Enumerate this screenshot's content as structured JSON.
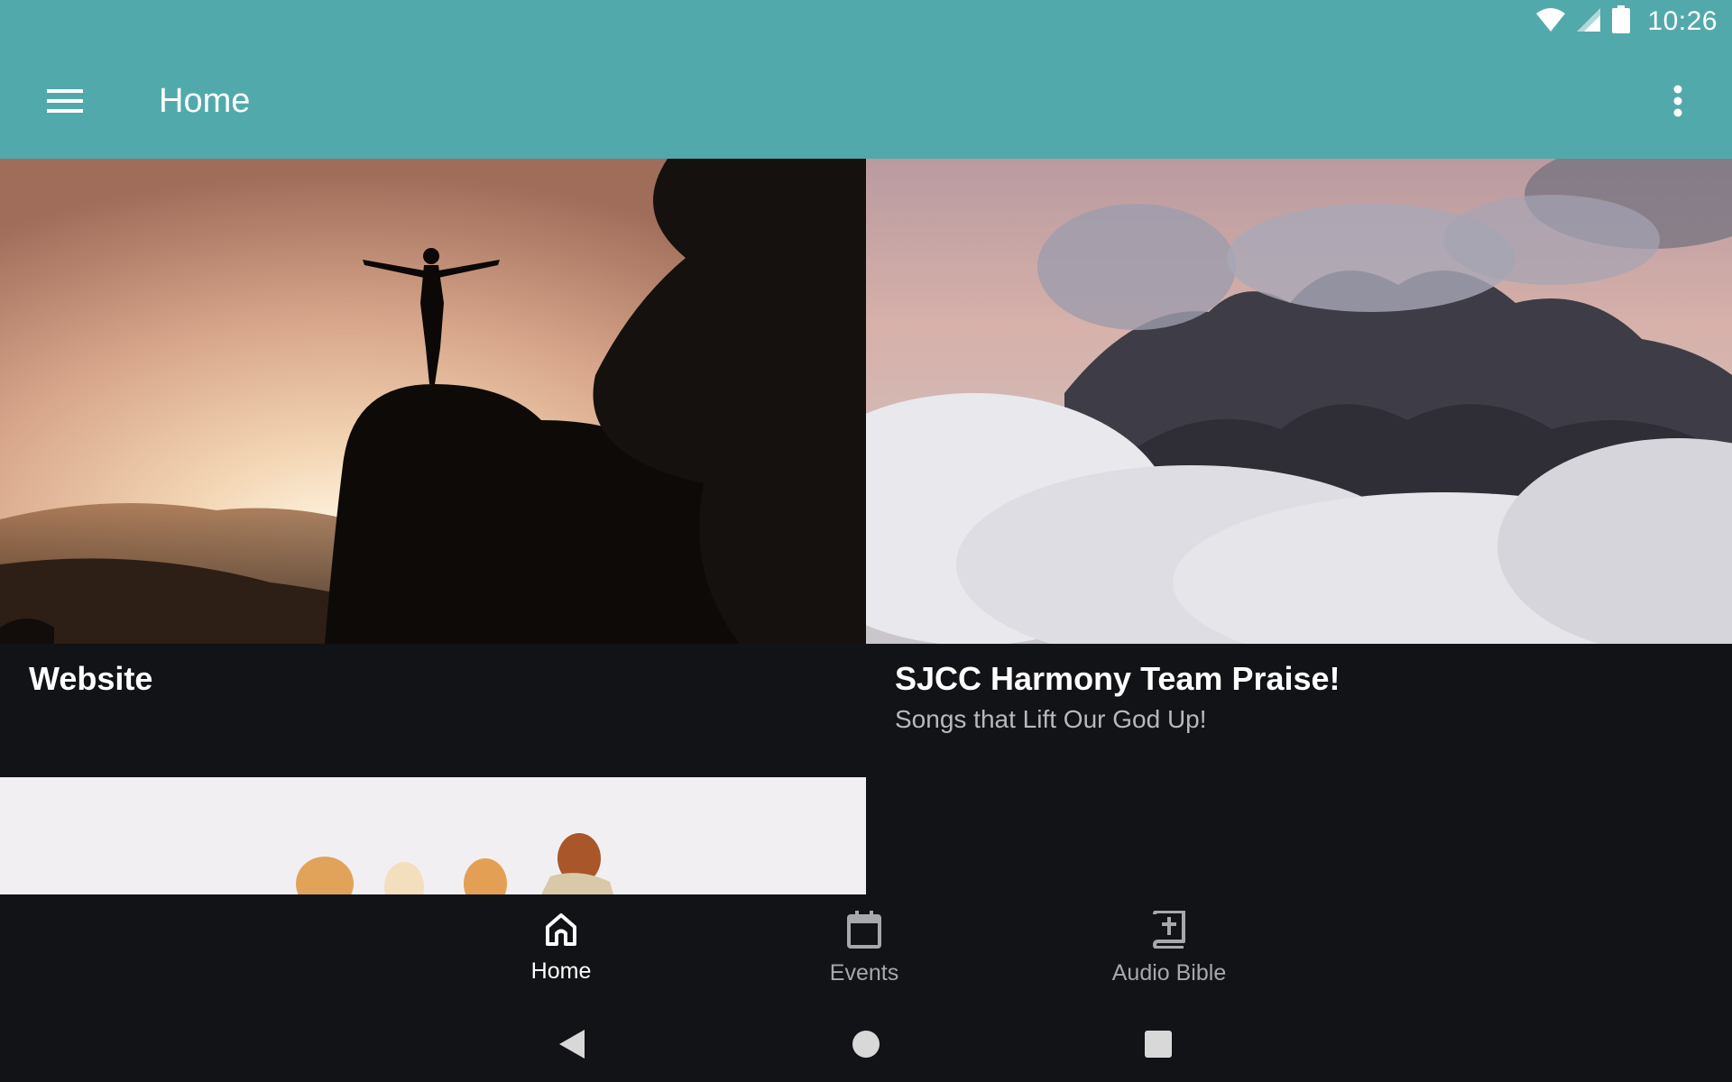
{
  "status_bar": {
    "time": "10:26",
    "icons": [
      "wifi-icon",
      "cellular-signal-icon",
      "battery-icon"
    ]
  },
  "toolbar": {
    "title": "Home",
    "menu_icon": "hamburger-menu-icon",
    "overflow_icon": "more-vert-icon",
    "background": "#52a9ab"
  },
  "cards": [
    {
      "title": "Website",
      "subtitle": "",
      "image": "silhouette-on-rock-at-sunset"
    },
    {
      "title": "SJCC Harmony Team Praise!",
      "subtitle": "Songs that Lift Our God Up!",
      "image": "mountains-above-clouds"
    },
    {
      "title": "",
      "subtitle": "",
      "image": "group-of-people-bright-sky"
    }
  ],
  "bottom_nav": {
    "items": [
      {
        "label": "Home",
        "icon": "home-icon",
        "active": true
      },
      {
        "label": "Events",
        "icon": "calendar-icon",
        "active": false
      },
      {
        "label": "Audio Bible",
        "icon": "bible-icon",
        "active": false
      }
    ]
  },
  "system_nav": {
    "buttons": [
      "back-icon",
      "home-circle-icon",
      "recents-icon"
    ]
  },
  "colors": {
    "accent": "#52a9ab",
    "background": "#121316",
    "text_primary": "#ffffff",
    "text_secondary": "#b8b9bd"
  }
}
